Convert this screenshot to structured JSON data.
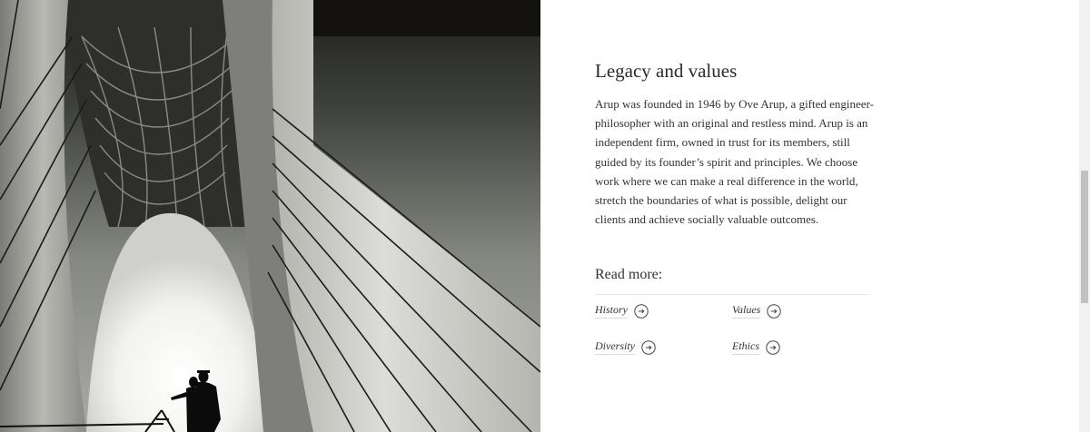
{
  "section": {
    "title": "Legacy and values",
    "body_lines": [
      "Arup was founded in 1946 by Ove Arup, a gifted engineer-",
      "philosopher with an original and restless mind. Arup is an",
      "independent firm, owned in trust for its members, still",
      "guided by its founder’s spirit and principles. We choose",
      "work where we can make a real difference in the world,",
      "stretch the boundaries of what is possible, delight our",
      "clients and achieve socially valuable outcomes."
    ]
  },
  "read_more": {
    "heading": "Read more:",
    "links": [
      {
        "label": "History",
        "icon": "arrow-right-circle-icon"
      },
      {
        "label": "Values",
        "icon": "arrow-right-circle-icon"
      },
      {
        "label": "Diversity",
        "icon": "arrow-right-circle-icon"
      },
      {
        "label": "Ethics",
        "icon": "arrow-right-circle-icon"
      }
    ]
  },
  "colors": {
    "text": "#333333",
    "heading": "#2b2b2b",
    "divider": "#e6e6e6",
    "background": "#ffffff"
  }
}
